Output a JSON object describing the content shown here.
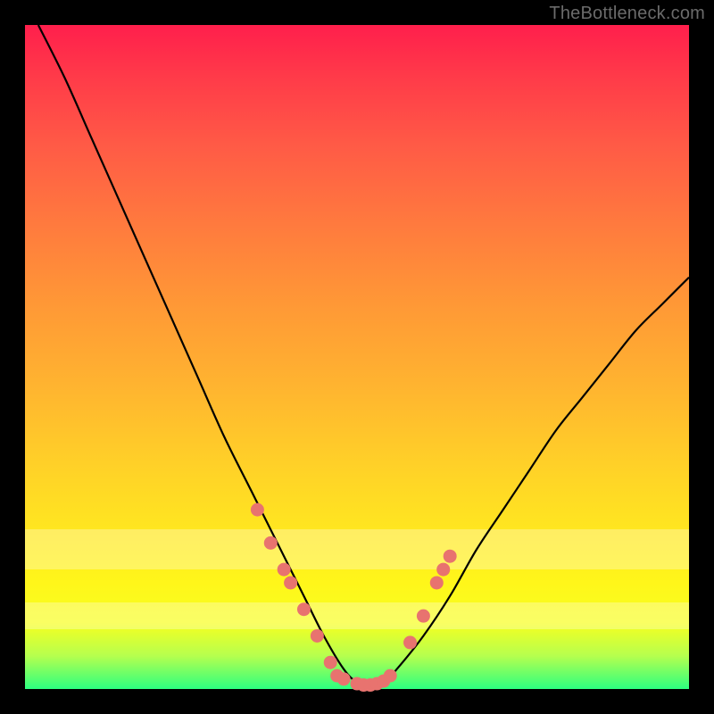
{
  "watermark": "TheBottleneck.com",
  "colors": {
    "dot": "#e8736f",
    "curve": "#000000"
  },
  "chart_data": {
    "type": "line",
    "title": "",
    "xlabel": "",
    "ylabel": "",
    "xlim": [
      0,
      100
    ],
    "ylim": [
      0,
      100
    ],
    "series": [
      {
        "name": "bottleneck-curve",
        "x": [
          2,
          6,
          10,
          14,
          18,
          22,
          26,
          30,
          34,
          38,
          42,
          45,
          48,
          50,
          52,
          54,
          56,
          60,
          64,
          68,
          72,
          76,
          80,
          84,
          88,
          92,
          96,
          100
        ],
        "y": [
          100,
          92,
          83,
          74,
          65,
          56,
          47,
          38,
          30,
          22,
          14,
          8,
          3,
          1,
          0.5,
          1,
          3,
          8,
          14,
          21,
          27,
          33,
          39,
          44,
          49,
          54,
          58,
          62
        ]
      }
    ],
    "markers": {
      "name": "highlighted-points",
      "x": [
        35,
        37,
        39,
        40,
        42,
        44,
        46,
        47,
        48,
        50,
        51,
        52,
        53,
        54,
        55,
        58,
        60,
        62,
        63,
        64
      ],
      "y": [
        27,
        22,
        18,
        16,
        12,
        8,
        4,
        2,
        1.5,
        0.8,
        0.6,
        0.6,
        0.8,
        1.2,
        2,
        7,
        11,
        16,
        18,
        20
      ]
    },
    "bands": [
      {
        "y0": 18,
        "y1": 24,
        "color": "#fffde0",
        "opacity": 0.35
      },
      {
        "y0": 9,
        "y1": 13,
        "color": "#fffde0",
        "opacity": 0.35
      }
    ]
  }
}
